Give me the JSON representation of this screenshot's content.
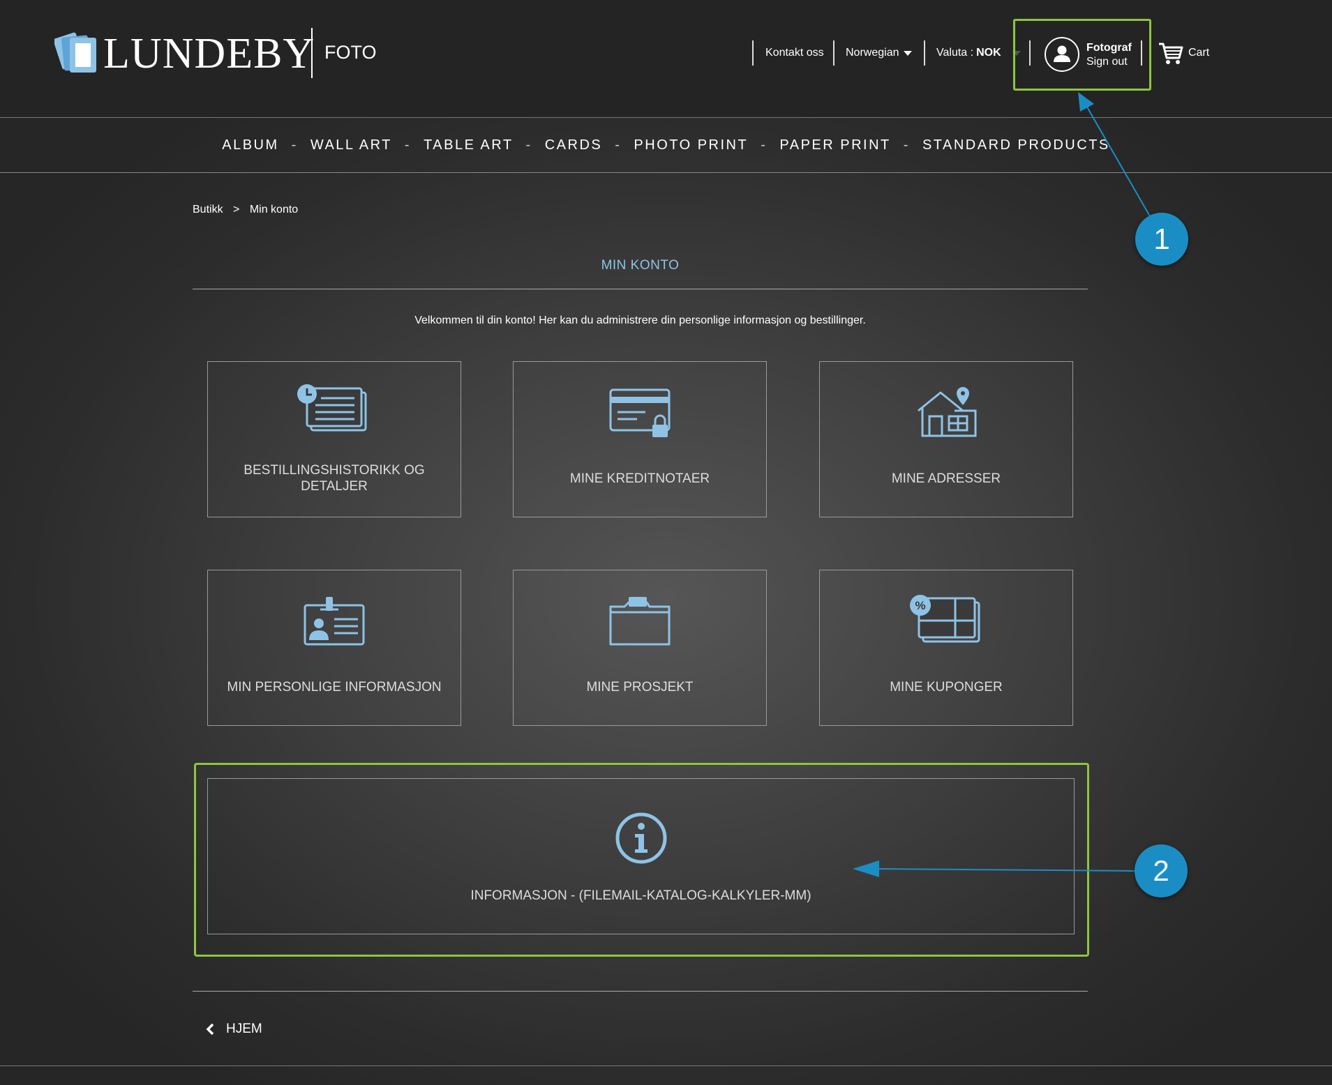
{
  "brand": {
    "name": "LUNDEBY",
    "sub": "FOTO"
  },
  "header": {
    "contact": "Kontakt oss",
    "language": "Norwegian",
    "currency_label": "Valuta :",
    "currency_value": "NOK",
    "user_name": "Fotograf",
    "sign_out": "Sign out",
    "cart": "Cart"
  },
  "nav": {
    "items": [
      "ALBUM",
      "WALL ART",
      "TABLE ART",
      "CARDS",
      "PHOTO PRINT",
      "PAPER PRINT",
      "STANDARD PRODUCTS"
    ],
    "separator": "-"
  },
  "breadcrumb": {
    "home": "Butikk",
    "separator": ">",
    "current": "Min konto"
  },
  "page": {
    "title": "MIN KONTO",
    "welcome": "Velkommen til din konto! Her kan du administrere din personlige informasjon og bestillinger."
  },
  "cards": [
    {
      "label": "BESTILLINGSHISTORIKK OG DETALJER",
      "icon": "order-history-icon"
    },
    {
      "label": "MINE KREDITNOTAER",
      "icon": "credit-card-lock-icon"
    },
    {
      "label": "MINE ADRESSER",
      "icon": "house-location-icon"
    },
    {
      "label": "MIN PERSONLIGE INFORMASJON",
      "icon": "id-badge-icon"
    },
    {
      "label": "MINE PROSJEKT",
      "icon": "folder-icon"
    },
    {
      "label": "MINE KUPONGER",
      "icon": "coupon-icon"
    }
  ],
  "info_card": {
    "label": "INFORMASJON - (FILEMAIL-KATALOG-KALKYLER-MM)",
    "icon": "info-icon"
  },
  "footer": {
    "home": "HJEM"
  },
  "annotations": {
    "callout_1": "1",
    "callout_2": "2"
  },
  "colors": {
    "accent_blue": "#8ec3e6",
    "highlight_green": "#8dc63f",
    "callout_blue": "#1a8ec4",
    "background": "#3e3e3e"
  }
}
